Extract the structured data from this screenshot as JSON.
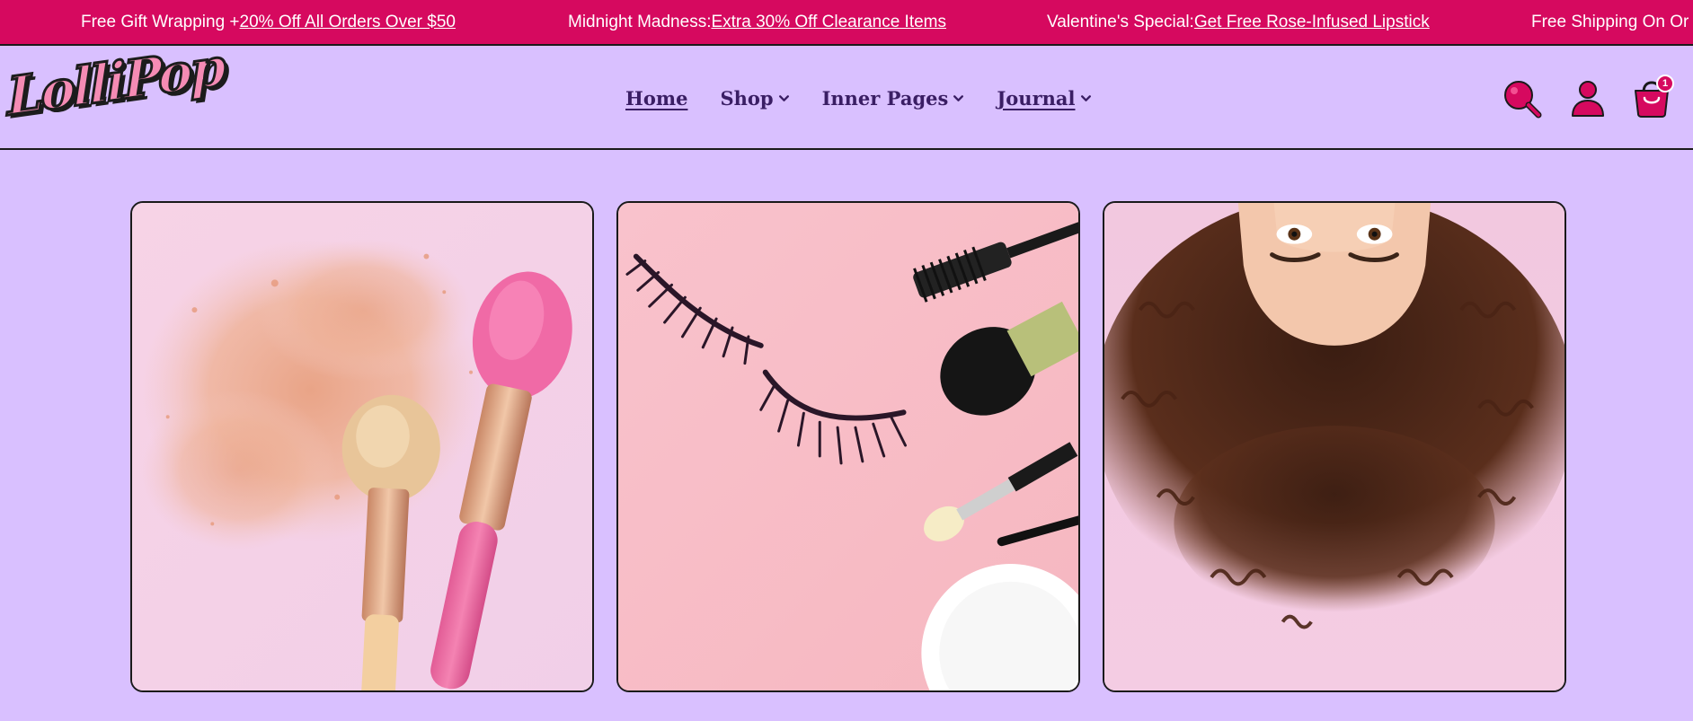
{
  "announcement_bar": {
    "items": [
      {
        "prefix": "Free Gift Wrapping + ",
        "link": "20% Off All Orders Over $50"
      },
      {
        "prefix": "Midnight Madness: ",
        "link": "Extra 30% Off Clearance Items"
      },
      {
        "prefix": "Valentine's Special: ",
        "link": "Get Free Rose-Infused Lipstick"
      },
      {
        "prefix": "Free Shipping On Or",
        "link": ""
      }
    ],
    "bg_color": "#d6095f"
  },
  "header": {
    "logo_text": "LolliPop",
    "nav": [
      {
        "label": "Home",
        "has_dropdown": false
      },
      {
        "label": "Shop",
        "has_dropdown": true
      },
      {
        "label": "Inner Pages",
        "has_dropdown": true
      },
      {
        "label": "Journal",
        "has_dropdown": true
      }
    ],
    "icons": {
      "search": "search-icon",
      "account": "user-icon",
      "cart": "cart-icon"
    },
    "cart_count": "1"
  },
  "gallery": {
    "cards": [
      {
        "image": "makeup-brushes-with-powder"
      },
      {
        "image": "false-eyelashes-and-brushes"
      },
      {
        "image": "woman-with-curly-hair-upside-down"
      }
    ]
  },
  "colors": {
    "page_bg": "#d9c0ff",
    "accent": "#d6095f",
    "nav_text": "#3a1e64"
  }
}
